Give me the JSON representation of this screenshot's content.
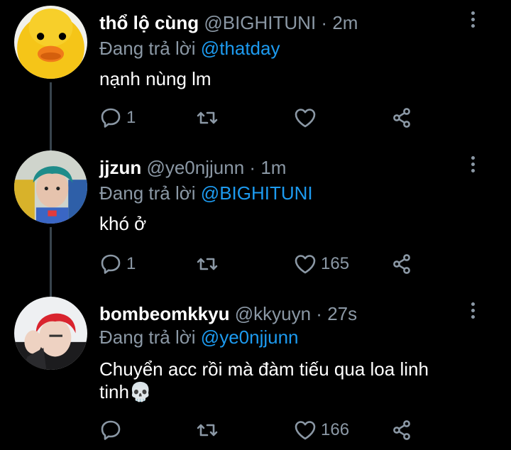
{
  "tweets": [
    {
      "name": "thổ lộ cùng",
      "handle": "@BIGHITUNI",
      "sep": "·",
      "time": "2m",
      "reply_prefix": "Đang trả lời",
      "reply_to": "@thatday",
      "text": "nạnh nùng lm",
      "avatar": "duck-avatar",
      "replies": "1",
      "retweets": "",
      "likes": ""
    },
    {
      "name": "jjzun",
      "handle": "@ye0njjunn",
      "sep": "·",
      "time": "1m",
      "reply_prefix": "Đang trả lời",
      "reply_to": "@BIGHITUNI",
      "text": "khó ở",
      "avatar": "teal-hair-avatar",
      "replies": "1",
      "retweets": "",
      "likes": "165"
    },
    {
      "name": "bombeomkkyu",
      "handle": "@kkyuyn",
      "sep": "·",
      "time": "27s",
      "reply_prefix": "Đang trả lời",
      "reply_to": "@ye0njjunn",
      "text": "Chuyển acc rồi mà đàm tiếu qua loa linh tinh💀",
      "avatar": "red-hair-avatar",
      "replies": "",
      "retweets": "",
      "likes": "166"
    }
  ],
  "icons": {
    "reply": "reply-icon",
    "retweet": "retweet-icon",
    "like": "heart-icon",
    "share": "share-icon",
    "more": "more-options-icon"
  },
  "colors": {
    "background": "#000000",
    "secondary_text": "#8b98a5",
    "link": "#1d9bf0",
    "thread_line": "#38444d"
  }
}
